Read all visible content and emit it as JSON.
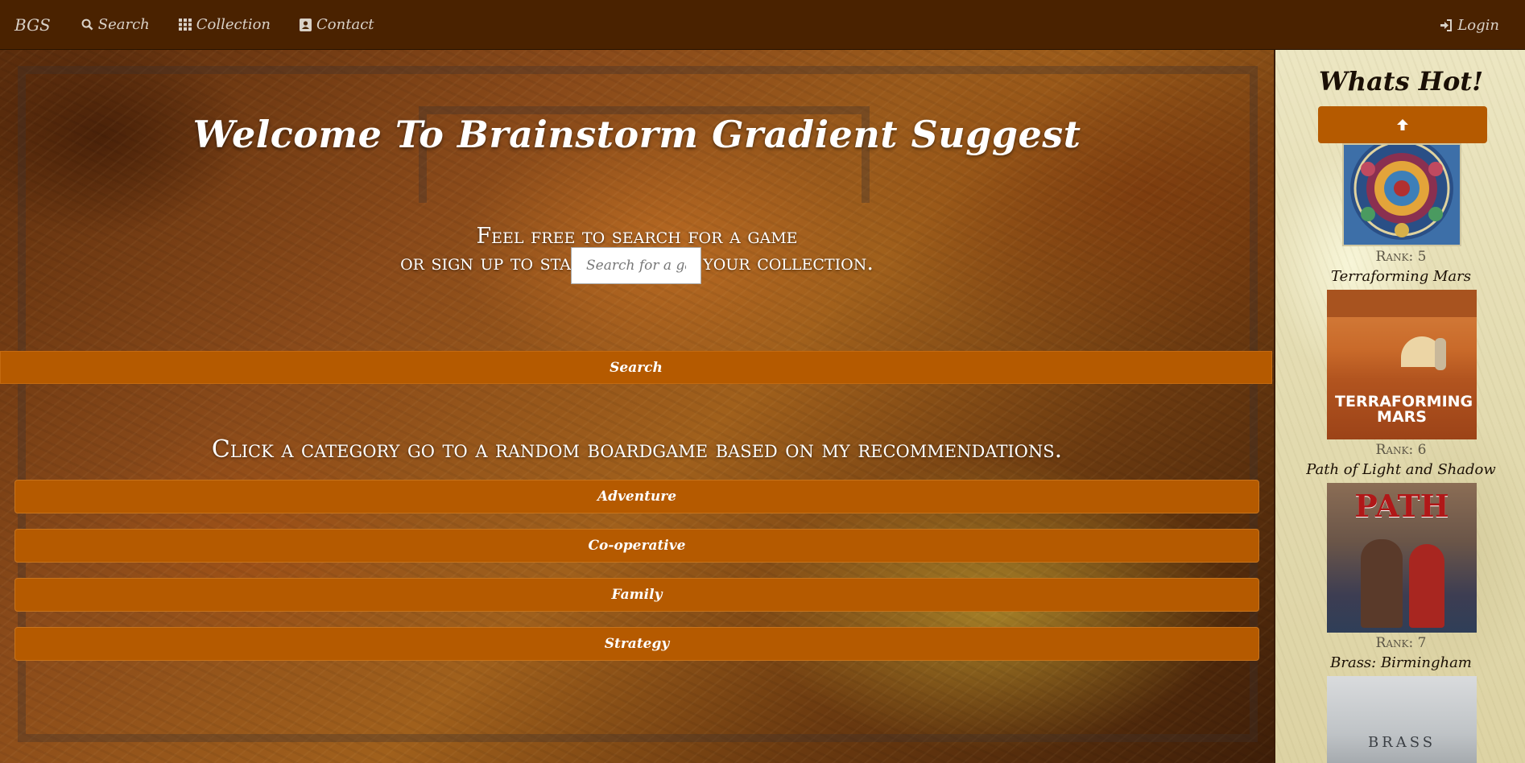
{
  "nav": {
    "brand": "BGS",
    "search": "Search",
    "collection": "Collection",
    "contact": "Contact",
    "login": "Login"
  },
  "hero": {
    "title": "Welcome To Brainstorm Gradient Suggest",
    "line1": "Feel free to search for a game",
    "line2": "or sign up to start adding to your collection.",
    "search_placeholder": "Search for a game",
    "search_button": "Search"
  },
  "categories": {
    "heading": "Click a category go to a random boardgame based on my recommendations.",
    "items": [
      "Adventure",
      "Co-operative",
      "Family",
      "Strategy"
    ]
  },
  "sidebar": {
    "title": "Whats Hot!",
    "games": [
      {
        "rank": "Rank: 5",
        "title": "Terraforming Mars",
        "cover_text": "TERRAFORMING MARS"
      },
      {
        "rank": "Rank: 6",
        "title": "Path of Light and Shadow",
        "cover_text": "PATH"
      },
      {
        "rank": "Rank: 7",
        "title": "Brass: Birmingham",
        "cover_text": "BRASS"
      }
    ]
  },
  "colors": {
    "navbar": "#4a2200",
    "button": "#b55a00",
    "sidebar_bg": "#e6dfb6"
  }
}
